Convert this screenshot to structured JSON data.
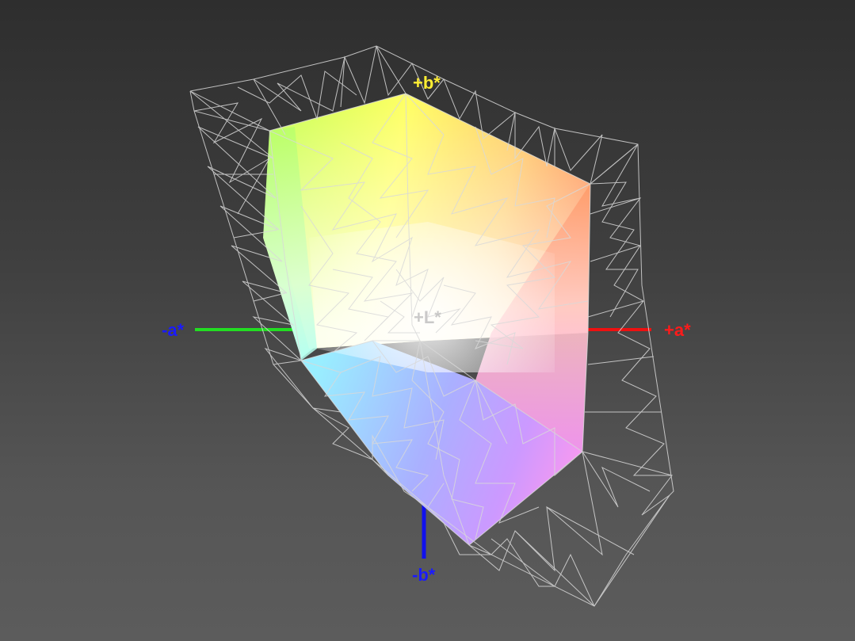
{
  "axes": {
    "plus_b": {
      "label": "+b*",
      "color": "#ffee33"
    },
    "minus_b": {
      "label": "-b*",
      "color": "#1a1aff"
    },
    "plus_a": {
      "label": "+a*",
      "color": "#ff1a1a"
    },
    "minus_a": {
      "label": "-a*",
      "color": "#1a1aff"
    },
    "center": {
      "label": "+L*",
      "color": "#bdbdbd"
    }
  },
  "colors": {
    "background": "#444444",
    "wireframe": "#d9d9d9",
    "axis_a_negative_line": "#22dd22",
    "axis_a_positive_line": "#ee1111",
    "axis_b_negative_line": "#1111ee"
  }
}
